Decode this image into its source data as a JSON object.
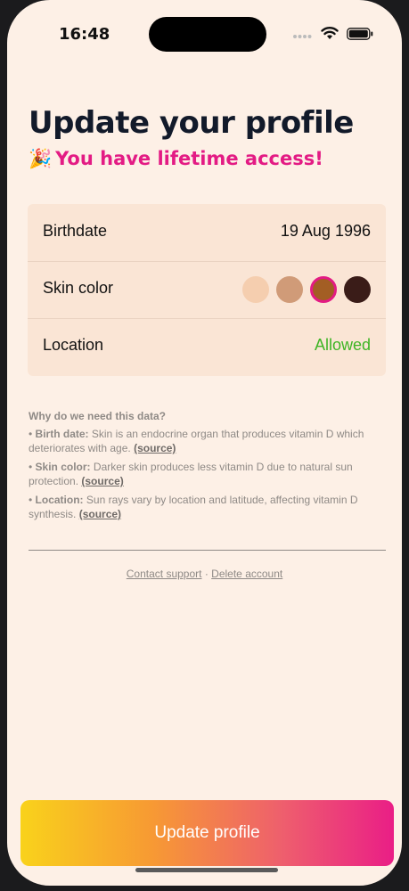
{
  "status_bar": {
    "time": "16:48"
  },
  "header": {
    "title": "Update your profile",
    "subtitle_emoji": "🎉",
    "subtitle": "You have lifetime access!"
  },
  "profile": {
    "birthdate_label": "Birthdate",
    "birthdate_value": "19 Aug 1996",
    "skin_label": "Skin color",
    "skin_swatches": [
      "#f5ceaf",
      "#d09b78",
      "#a35e24",
      "#3a1c18"
    ],
    "skin_selected_index": 2,
    "location_label": "Location",
    "location_value": "Allowed"
  },
  "info": {
    "heading": "Why do we need this data?",
    "items": [
      {
        "term": "Birth date:",
        "text": "Skin is an endocrine organ that produces vitamin D which deteriorates with age.",
        "source": "(source)"
      },
      {
        "term": "Skin color:",
        "text": "Darker skin produces less vitamin D due to natural sun protection.",
        "source": "(source)"
      },
      {
        "term": "Location:",
        "text": "Sun rays vary by location and latitude, affecting vitamin D synthesis.",
        "source": "(source)"
      }
    ]
  },
  "footer": {
    "contact_support": "Contact support",
    "separator": "·",
    "delete_account": "Delete account"
  },
  "cta": {
    "label": "Update profile"
  },
  "colors": {
    "accent_pink": "#e31b84",
    "allowed_green": "#3fb526",
    "background": "#fdf0e6",
    "card": "#fae5d5"
  }
}
